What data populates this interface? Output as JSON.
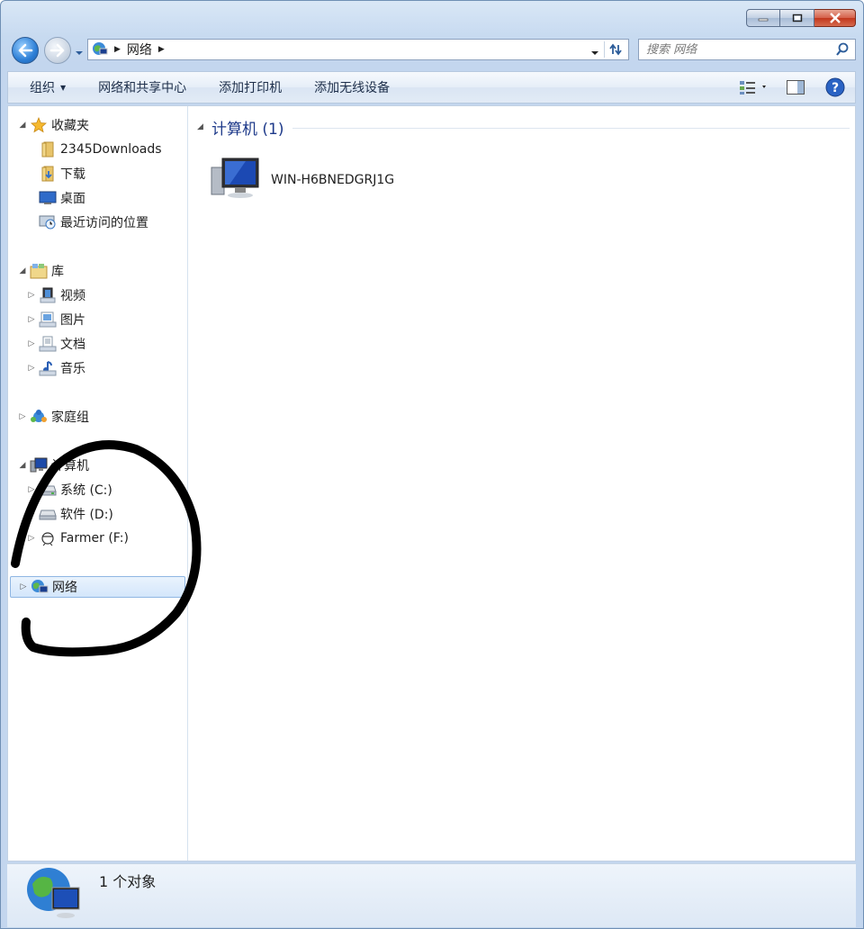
{
  "address": {
    "crumbs": [
      "网络"
    ]
  },
  "search": {
    "placeholder": "搜索 网络"
  },
  "toolbar": {
    "organize": "组织",
    "items": [
      "网络和共享中心",
      "添加打印机",
      "添加无线设备"
    ]
  },
  "nav": {
    "favorites": {
      "label": "收藏夹",
      "items": [
        "2345Downloads",
        "下载",
        "桌面",
        "最近访问的位置"
      ]
    },
    "libraries": {
      "label": "库",
      "items": [
        "视频",
        "图片",
        "文档",
        "音乐"
      ]
    },
    "homegroup": {
      "label": "家庭组"
    },
    "computer": {
      "label": "计算机",
      "items": [
        "系统 (C:)",
        "软件 (D:)",
        "Farmer (F:)"
      ]
    },
    "network": {
      "label": "网络"
    }
  },
  "main": {
    "group_title": "计算机 (1)",
    "items": [
      "WIN-H6BNEDGRJ1G"
    ]
  },
  "status": {
    "count": "1 个对象"
  },
  "colors": {
    "accent": "#1e3a8a",
    "selection": "#d3e6fb",
    "chrome": "#c7daf0"
  },
  "icons": [
    "minimize-icon",
    "maximize-icon",
    "close-icon",
    "back-arrow-icon",
    "forward-arrow-icon",
    "network-icon",
    "refresh-icon",
    "search-icon",
    "view-options-icon",
    "preview-pane-icon",
    "help-icon",
    "star-icon",
    "folder-icon",
    "desktop-icon",
    "recent-places-icon",
    "library-icon",
    "video-icon",
    "pictures-icon",
    "documents-icon",
    "music-icon",
    "homegroup-icon",
    "computer-icon",
    "drive-icon",
    "usb-drive-icon"
  ]
}
